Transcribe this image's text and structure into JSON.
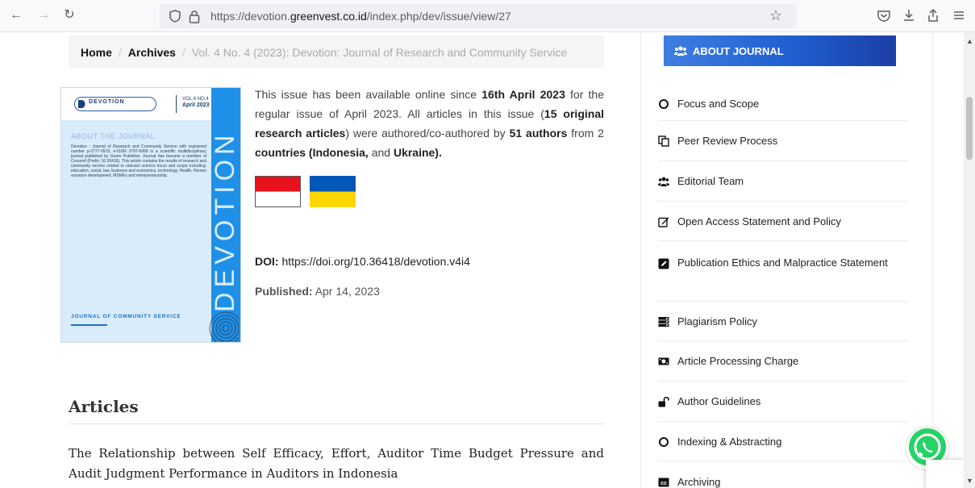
{
  "browser": {
    "url_prefix": "https://devotion.",
    "url_domain": "greenvest.co.id",
    "url_suffix": "/index.php/dev/issue/view/27"
  },
  "breadcrumb": {
    "home": "Home",
    "archives": "Archives",
    "current": "Vol. 4 No. 4 (2023): Devotion: Journal of Research and Community Service"
  },
  "cover": {
    "logo": "DEVOTION",
    "vol_line1": "VOL.4 NO.4",
    "vol_line2": "April 2023",
    "about_heading": "ABOUT THE JOURNAL",
    "about_text": "Devotion : Journal of Research and Community Service with registered number p-2777-0915, e-ISSN 2797-6068 is a scientific multidisciplinary journal published by Green Publisher. Journal has become a member of Crossref (Prefix: 10.36418). This article contains the results of research and community service related to relevant science focus and scope including: education, social, law, business and economics, technology, Health, Human resource development, MSMEs and entrepreneurship.",
    "vertical_title": "DEVOTION",
    "footer": "JOURNAL OF COMMUNITY SERVICE"
  },
  "intro": {
    "t1": "This issue has been available online since ",
    "b1": "16th April 2023",
    "t2": " for the regular issue of April 2023. All articles in this issue (",
    "b2": "15 original research articles",
    "t3": ") were authored/co-authored by ",
    "b3": "51 authors",
    "t4": " from 2 ",
    "b4": "countries (Indonesia,",
    "t5": " and ",
    "b5": "Ukraine).",
    "t6": ""
  },
  "flags": [
    {
      "name": "Indonesia",
      "top": "#e8111c",
      "bottom": "#ffffff"
    },
    {
      "name": "Ukraine",
      "top": "#0057b7",
      "bottom": "#ffd700"
    }
  ],
  "doi": {
    "label": "DOI:",
    "value": "https://doi.org/10.36418/devotion.v4i4"
  },
  "published": {
    "label": "Published:",
    "value": "Apr 14, 2023"
  },
  "articles": {
    "heading": "Articles",
    "first_title": "The Relationship between Self Efficacy, Effort, Auditor Time Budget Pressure and Audit Judgment Performance in Auditors in Indonesia"
  },
  "sidebar": {
    "header": "ABOUT JOURNAL",
    "items": [
      {
        "label": "Focus and Scope",
        "icon": "circle-icon"
      },
      {
        "label": "Peer Review Process",
        "icon": "copy-icon"
      },
      {
        "label": "Editorial Team",
        "icon": "users-icon"
      },
      {
        "label": "Open Access Statement and Policy",
        "icon": "edit-icon"
      },
      {
        "label": "Publication Ethics and Malpractice Statement",
        "icon": "pencil-square-icon"
      },
      {
        "label": "Plagiarism Policy",
        "icon": "server-icon"
      },
      {
        "label": "Article Processing Charge",
        "icon": "money-icon"
      },
      {
        "label": "Author Guidelines",
        "icon": "unlock-icon"
      },
      {
        "label": "Indexing & Abstracting",
        "icon": "circle-icon"
      },
      {
        "label": "Archiving",
        "icon": "cc-icon"
      }
    ]
  },
  "colors": {
    "accent": "#1e90e8",
    "header_blue": "#1f5fd0",
    "whatsapp": "#25d366"
  }
}
